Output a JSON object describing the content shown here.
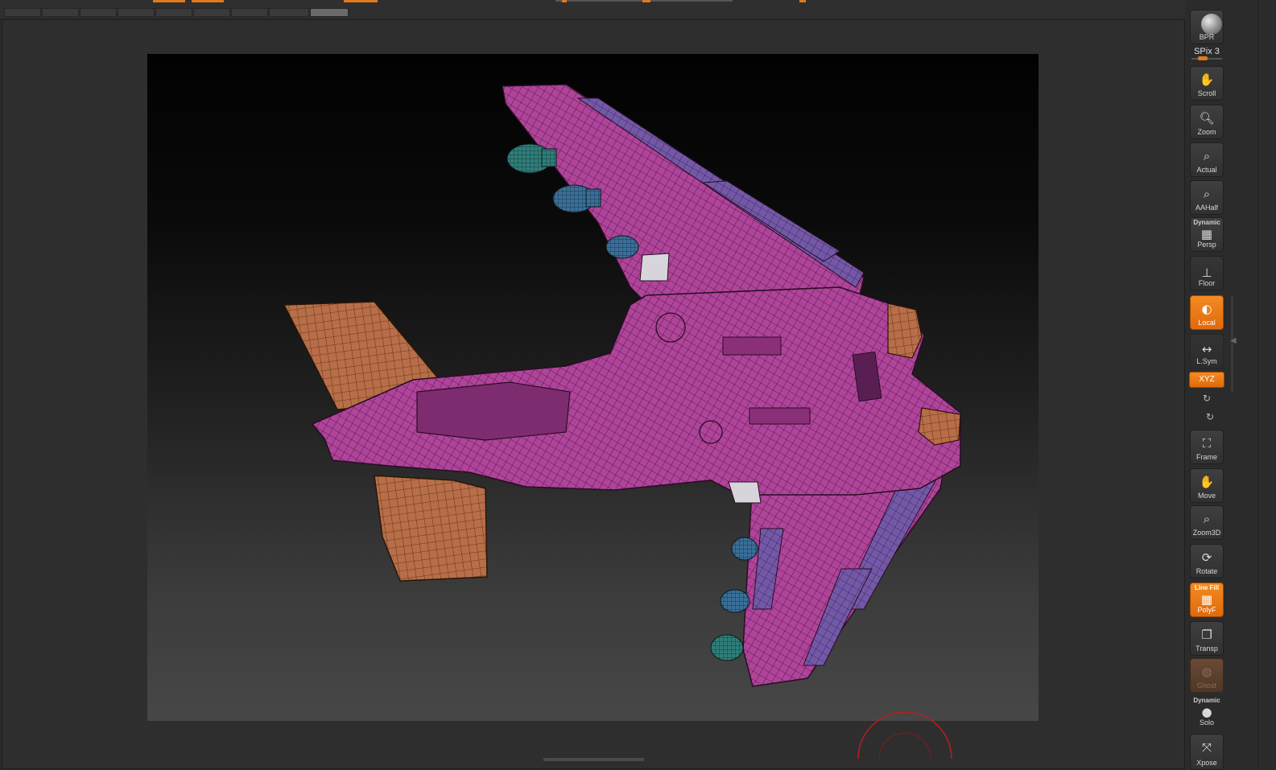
{
  "shelf": {
    "bpr": "BPR",
    "spix": "SPix 3",
    "scroll": "Scroll",
    "zoom": "Zoom",
    "actual": "Actual",
    "aahalf": "AAHalf",
    "persp_sup": "Dynamic",
    "persp": "Persp",
    "floor": "Floor",
    "local": "Local",
    "lsym": "L.Sym",
    "xyz": "XYZ",
    "frame": "Frame",
    "move": "Move",
    "zoom3d": "Zoom3D",
    "rotate": "Rotate",
    "polyf_sup": "Line Fill",
    "polyf": "PolyF",
    "transp": "Transp",
    "ghost": "Ghost",
    "solo_sup": "Dynamic",
    "solo": "Solo",
    "xpose": "Xpose"
  },
  "colors": {
    "accent_orange": "#e8761a",
    "hull_magenta": "#b0449a",
    "panel_violet": "#7458a8",
    "tail_orange": "#b86e48",
    "thruster_teal": "#2f7e7a",
    "thruster_blue": "#3a6f98"
  },
  "icons": {
    "scroll": "hand-icon",
    "zoom": "magnifier-icon",
    "actual": "magnifier-icon",
    "aahalf": "magnifier-icon",
    "persp": "grid-perspective-icon",
    "floor": "floor-icon",
    "local": "local-pivot-icon",
    "lsym": "symmetry-arrows-icon",
    "frame": "frame-icon",
    "move": "hand-icon",
    "zoom3d": "magnifier-icon",
    "rotate": "rotate-icon",
    "polyf": "polyframe-grid-icon",
    "transp": "transparency-icon",
    "ghost": "ghost-icon",
    "solo": "solo-spheres-icon",
    "xpose": "xpose-arrows-icon"
  }
}
